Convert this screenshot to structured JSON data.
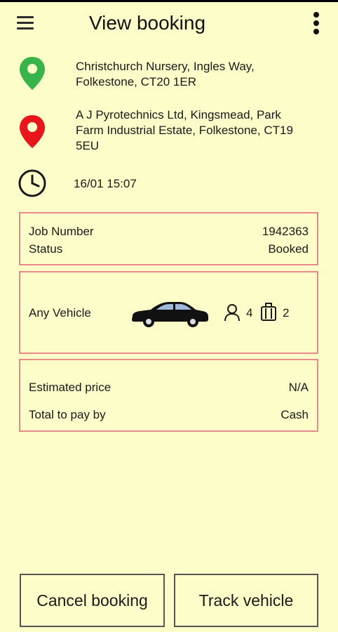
{
  "header": {
    "title": "View booking",
    "menu_icon": "hamburger-menu-icon",
    "overflow_icon": "more-vert-icon"
  },
  "booking": {
    "pickup": {
      "icon": "green-map-pin-icon",
      "color": "#38b44a",
      "line1": "Christchurch Nursery, Ingles Way,",
      "line2": "Folkestone, CT20 1ER"
    },
    "dropoff": {
      "icon": "red-map-pin-icon",
      "color": "#e8151b",
      "line1": "A J Pyrotechnics Ltd, Kingsmead, Park",
      "line2": "Farm Industrial Estate, Folkestone, CT19",
      "line3": "5EU"
    },
    "time": {
      "icon": "clock-icon",
      "value": "16/01 15:07"
    }
  },
  "job_card": {
    "job_number_label": "Job Number",
    "job_number": "1942363",
    "status_label": "Status",
    "status": "Booked"
  },
  "vehicle_card": {
    "label": "Any Vehicle",
    "car_icon": "car-icon",
    "passenger_icon": "person-icon",
    "passengers": "4",
    "luggage_icon": "luggage-icon",
    "luggage": "2"
  },
  "price_card": {
    "estimated_price_label": "Estimated price",
    "estimated_price": "N/A",
    "payment_label": "Total to pay by",
    "payment": "Cash"
  },
  "actions": {
    "cancel_label": "Cancel booking",
    "track_label": "Track vehicle"
  },
  "colors": {
    "background": "#fdfdc9",
    "card_border": "#e88a8a",
    "button_border": "#555555"
  }
}
